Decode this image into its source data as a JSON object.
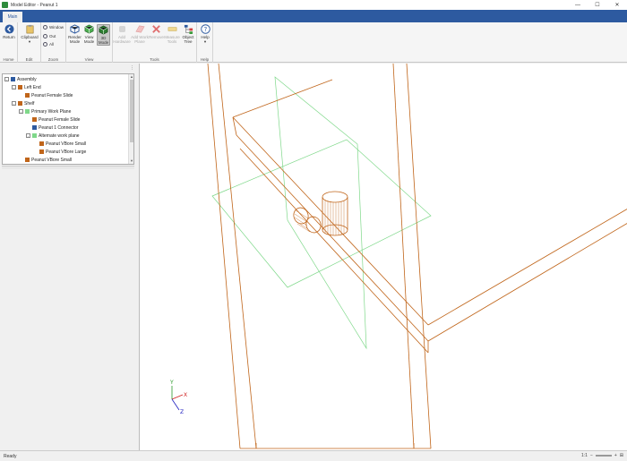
{
  "window": {
    "title": "Model Editor - Peanut 1",
    "minimize": "—",
    "maximize": "☐",
    "close": "✕"
  },
  "tabs": {
    "main": "Main"
  },
  "ribbon": {
    "home": {
      "label": "Home",
      "return_label": "Return"
    },
    "edit": {
      "label": "Edit",
      "clipboard_label": "Clipboard"
    },
    "zoom": {
      "label": "Zoom",
      "window_label": "Window",
      "out_label": "Out",
      "all_label": "All"
    },
    "view": {
      "label": "View",
      "render_mode_label": "Render Mode",
      "view_mode_label": "View Mode",
      "mode_3d_label": "3D Mode"
    },
    "tools": {
      "label": "Tools",
      "add_hardware_label": "Add Hardware",
      "add_work_plane_label": "Add Work Plane",
      "remove_label": "Remove",
      "measure_tools_label": "Measure Tools",
      "object_tree_label": "Object Tree"
    },
    "help": {
      "label": "Help",
      "help_label": "Help"
    }
  },
  "tree": {
    "items": [
      {
        "label": "Assembly",
        "depth": 0,
        "expander": "-"
      },
      {
        "label": "Left End",
        "depth": 1,
        "expander": "-"
      },
      {
        "label": "Peanut Female Slide",
        "depth": 2,
        "expander": ""
      },
      {
        "label": "Shelf",
        "depth": 1,
        "expander": "-"
      },
      {
        "label": "Primary Work Plane",
        "depth": 2,
        "expander": "-"
      },
      {
        "label": "Peanut Female Slide",
        "depth": 3,
        "expander": ""
      },
      {
        "label": "Peanut 1 Connector",
        "depth": 3,
        "expander": ""
      },
      {
        "label": "Alternate work plane",
        "depth": 3,
        "expander": "-"
      },
      {
        "label": "Peanut VBore Small",
        "depth": 4,
        "expander": ""
      },
      {
        "label": "Peanut VBore Large",
        "depth": 4,
        "expander": ""
      },
      {
        "label": "Peanut VBore Small",
        "depth": 2,
        "expander": ""
      }
    ]
  },
  "axes": {
    "x": "X",
    "y": "Y",
    "z": "Z"
  },
  "status": {
    "text": "Ready",
    "zoom": "1:1"
  },
  "colors": {
    "accent": "#2d5aa0",
    "model": "#c0651a",
    "plane": "#7fd88a"
  }
}
